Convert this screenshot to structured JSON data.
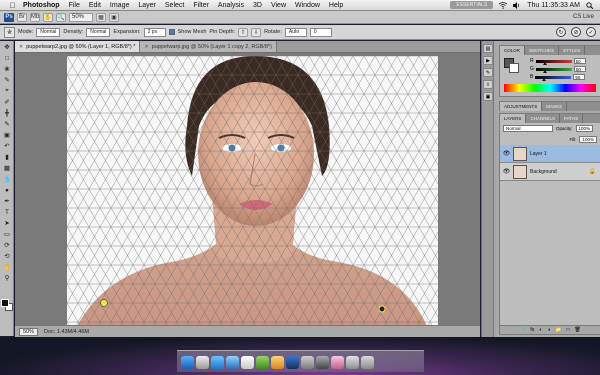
{
  "menubar": {
    "app_name": "Photoshop",
    "items": [
      "File",
      "Edit",
      "Image",
      "Layer",
      "Select",
      "Filter",
      "Analysis",
      "3D",
      "View",
      "Window",
      "Help"
    ],
    "clock": "Thu 11:35:33 AM",
    "workspace": "ESSENTIALS"
  },
  "appbar": {
    "logo": "Ps",
    "zoom": "50%",
    "cs_live": "CS Live"
  },
  "options": {
    "mode_label": "Mode:",
    "mode_value": "Normal",
    "density_label": "Density:",
    "density_value": "Normal",
    "expansion_label": "Expansion:",
    "expansion_value": "2 px",
    "show_mesh_label": "Show Mesh",
    "pin_depth_label": "Pin Depth:",
    "rotate_label": "Rotate:",
    "rotate_value": "Auto",
    "rotate_angle": "0"
  },
  "tabs": [
    {
      "label": "puppetwarp2.jpg @ 50% (Layer 1, RGB/8*) *",
      "active": true
    },
    {
      "label": "puppetwarp.jpg @ 50% (Layer 1 copy 2, RGB/8*)",
      "active": false
    }
  ],
  "status": {
    "zoom": "50%",
    "doc": "Doc: 1.43M/4.46M"
  },
  "color_panel": {
    "tabs": [
      "COLOR",
      "SWATCHES",
      "STYLES"
    ],
    "rows": [
      {
        "label": "R",
        "value": "50",
        "color": "#d23b3b"
      },
      {
        "label": "G",
        "value": "50",
        "color": "#3fa83f"
      },
      {
        "label": "B",
        "value": "50",
        "color": "#3b5fd2"
      }
    ]
  },
  "adjust_panel": {
    "tabs": [
      "ADJUSTMENTS",
      "MASKS"
    ]
  },
  "layers_panel": {
    "tabs": [
      "LAYERS",
      "CHANNELS",
      "PATHS"
    ],
    "blend_mode": "Normal",
    "opacity_label": "Opacity:",
    "opacity_value": "100%",
    "fill_label": "Fill:",
    "fill_value": "100%",
    "layers": [
      {
        "name": "Layer 1",
        "selected": true
      },
      {
        "name": "Background",
        "selected": false
      }
    ]
  }
}
